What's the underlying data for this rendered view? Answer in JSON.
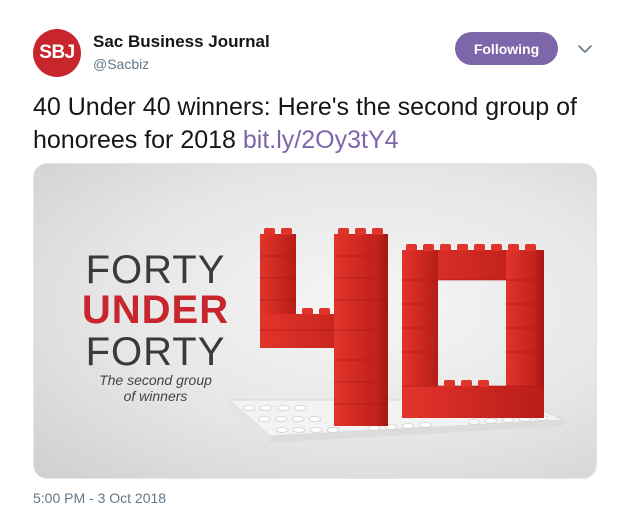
{
  "author": {
    "avatar_text": "SBJ",
    "name": "Sac Business Journal",
    "handle": "@Sacbiz"
  },
  "follow_button": {
    "label": "Following",
    "color": "#7d66a9"
  },
  "menu": {
    "icon": "chevron-down-icon"
  },
  "tweet": {
    "text": "40 Under 40 winners: Here's the second group of honorees for 2018 ",
    "link": "bit.ly/2Oy3tY4"
  },
  "media": {
    "title_line1": "FORTY",
    "title_line2": "UNDER",
    "title_line3": "FORTY",
    "subtitle_line1": "The second group",
    "subtitle_line2": "of winners",
    "brick_color": "#d3261f",
    "baseplate_color": "#f2f2f2"
  },
  "timestamp": "5:00 PM - 3 Oct 2018"
}
